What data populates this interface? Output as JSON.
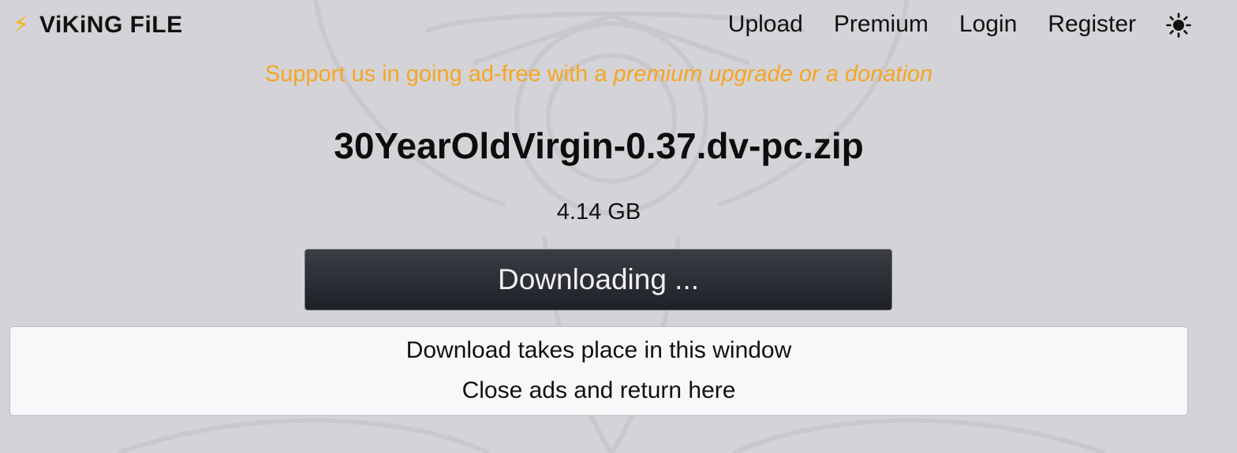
{
  "brand": {
    "icon": "lightning-bolt-icon",
    "name": "ViKiNG FiLE",
    "accent_color": "#f6b21a"
  },
  "nav": {
    "items": [
      {
        "label": "Upload"
      },
      {
        "label": "Premium"
      },
      {
        "label": "Login"
      },
      {
        "label": "Register"
      }
    ],
    "theme_toggle_icon": "sun-icon"
  },
  "promo": {
    "text": "Support us in going ad-free with a ",
    "link_text": "premium upgrade or a donation",
    "color": "#f5a623"
  },
  "file": {
    "name": "30YearOldVirgin-0.37.dv-pc.zip",
    "size": "4.14 GB"
  },
  "download_button": {
    "label": "Downloading ..."
  },
  "notice": {
    "line1": "Download takes place in this window",
    "line2": "Close ads and return here"
  }
}
